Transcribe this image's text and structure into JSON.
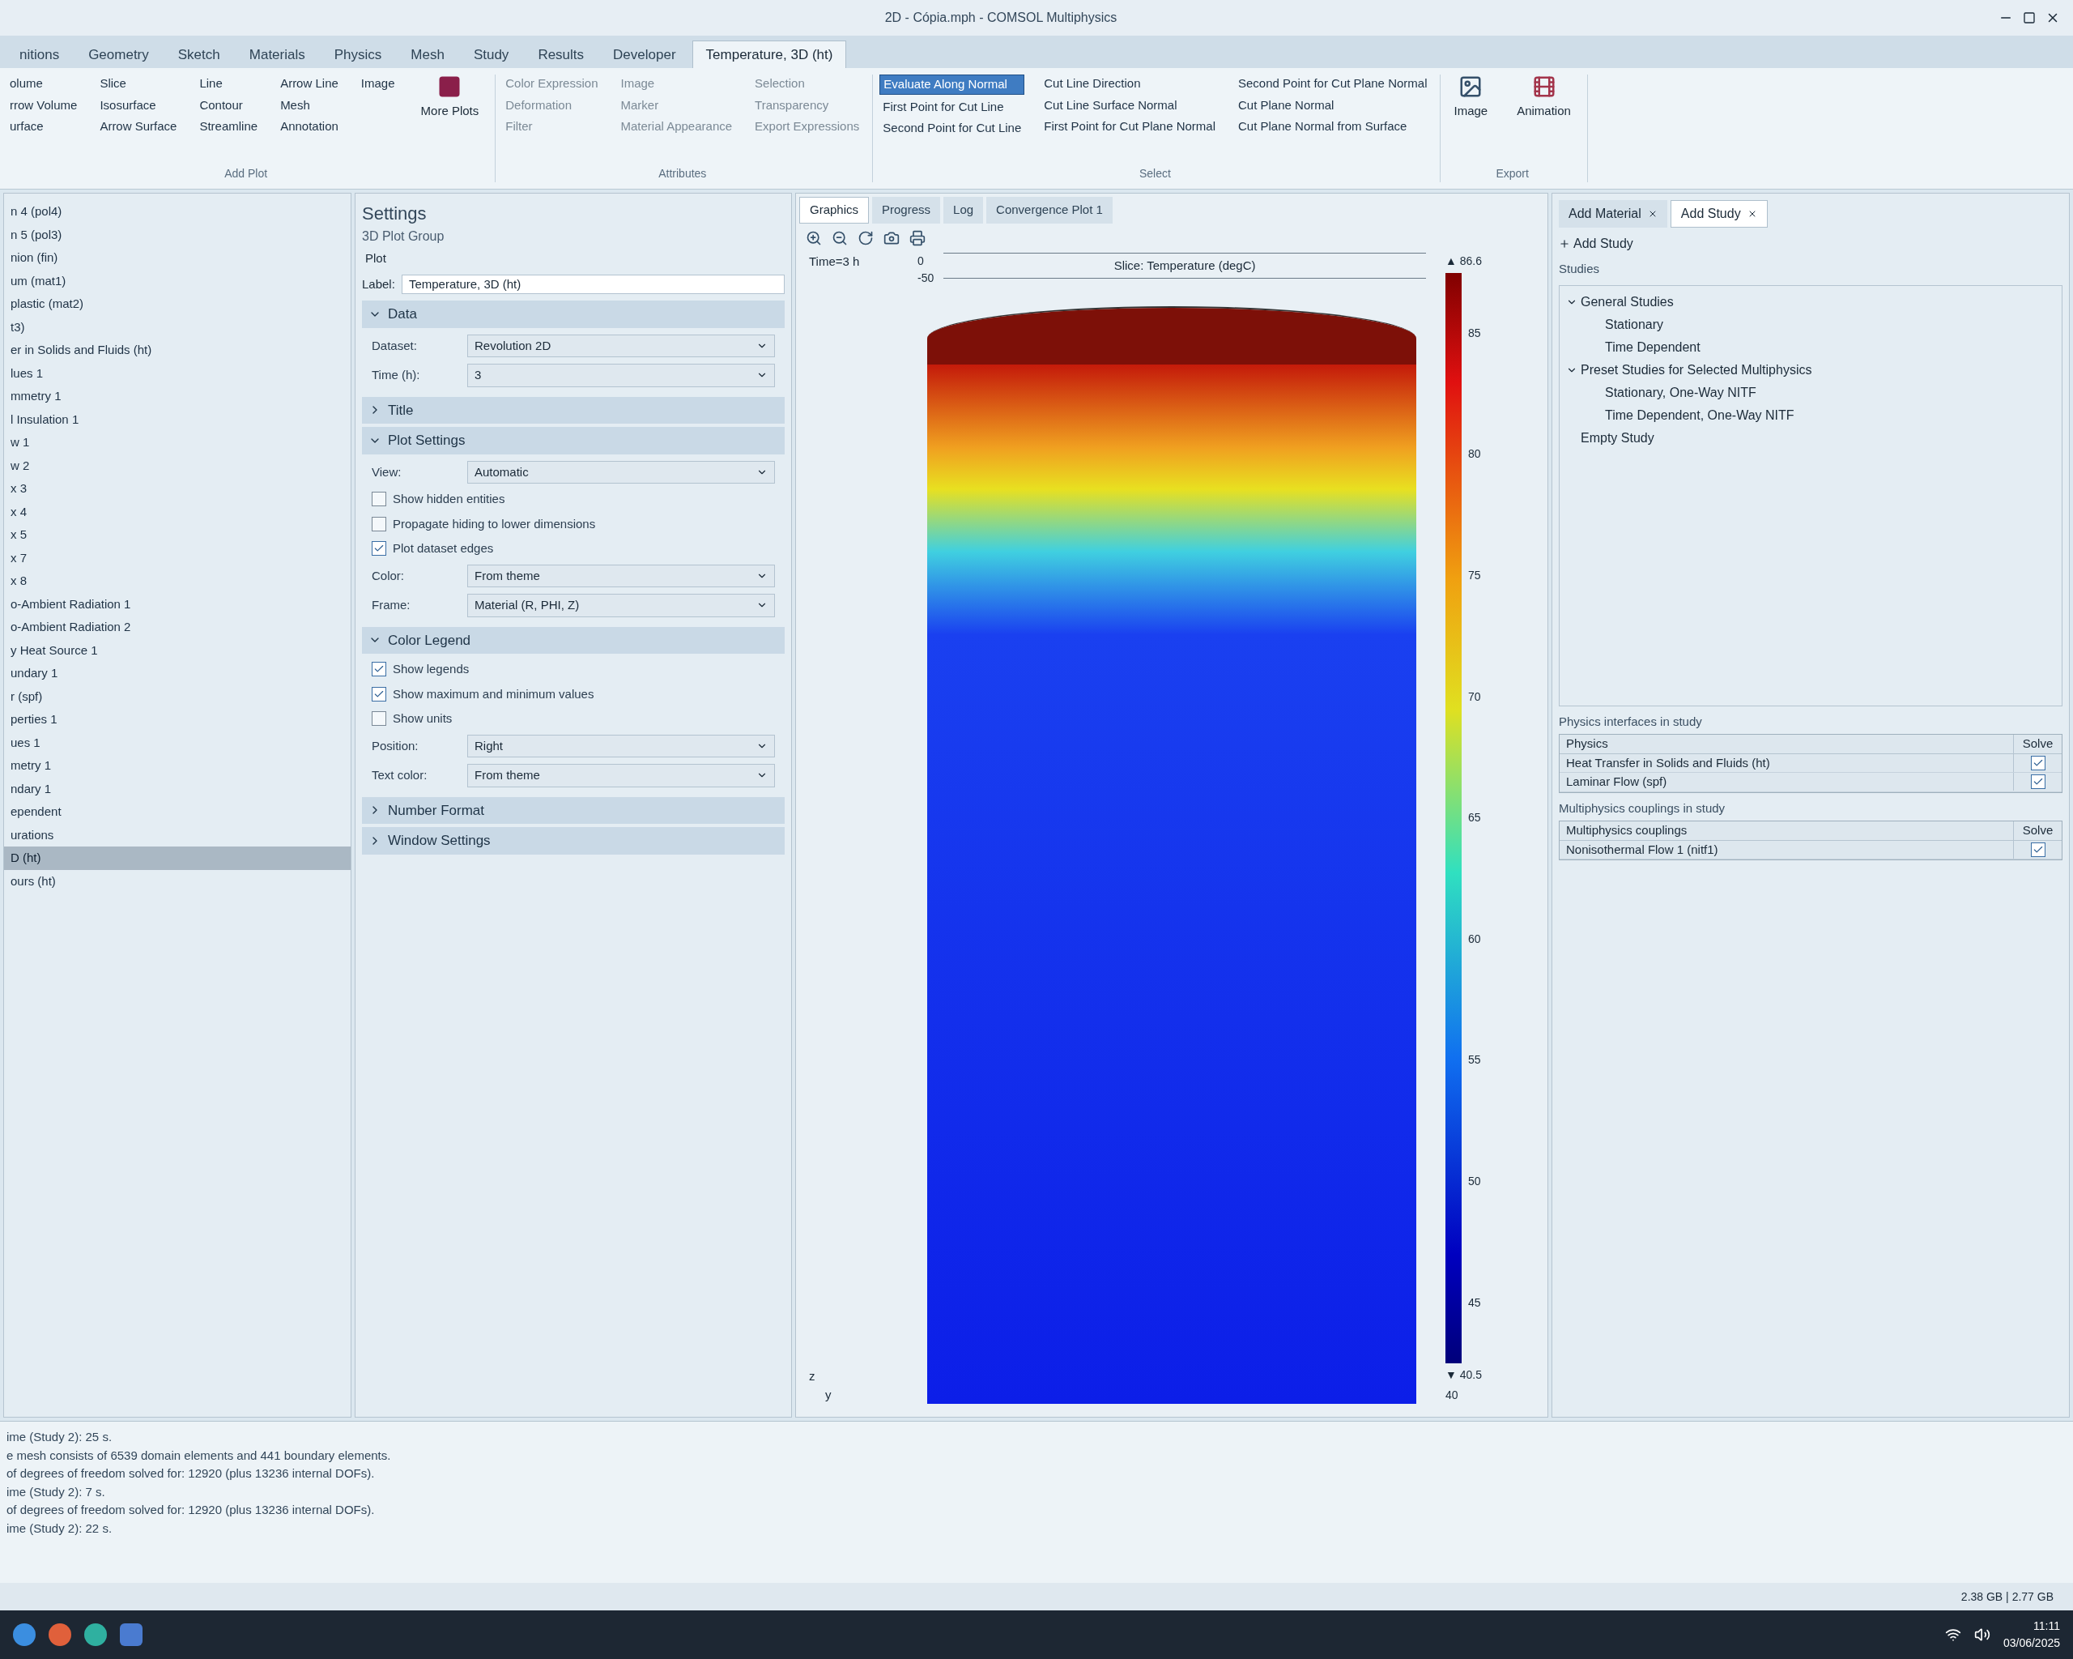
{
  "window": {
    "title": "2D - Cópia.mph - COMSOL Multiphysics"
  },
  "ribbon": {
    "tabs": [
      {
        "label": "nitions",
        "selected": false
      },
      {
        "label": "Geometry",
        "selected": false
      },
      {
        "label": "Sketch",
        "selected": false
      },
      {
        "label": "Materials",
        "selected": false
      },
      {
        "label": "Physics",
        "selected": false
      },
      {
        "label": "Mesh",
        "selected": false
      },
      {
        "label": "Study",
        "selected": false
      },
      {
        "label": "Results",
        "selected": false
      },
      {
        "label": "Developer",
        "selected": false
      },
      {
        "label": "Temperature, 3D (ht)",
        "selected": true
      }
    ],
    "groups": [
      {
        "title": "Add Plot",
        "columns": [
          [
            "olume",
            "rrow Volume",
            "urface"
          ],
          [
            "Slice",
            "Isosurface",
            "Arrow Surface"
          ],
          [
            "Line",
            "Contour",
            "Streamline"
          ],
          [
            "Arrow Line",
            "Mesh",
            "Annotation"
          ],
          [
            "Image"
          ]
        ],
        "large": [
          "More Plots"
        ]
      },
      {
        "title": "Attributes",
        "columns": [
          [
            "Color Expression",
            "Deformation",
            "Filter"
          ],
          [
            "Image",
            "Marker",
            "Material Appearance"
          ],
          [
            "Selection",
            "Transparency",
            "Export Expressions"
          ]
        ]
      },
      {
        "title": "Select",
        "columns": [
          [
            "Evaluate Along Normal",
            "First Point for Cut Line",
            "Second Point for Cut Line"
          ],
          [
            "Cut Line Direction",
            "Cut Line Surface Normal",
            "First Point for Cut Plane Normal"
          ],
          [
            "Second Point for Cut Plane Normal",
            "Cut Plane Normal",
            "Cut Plane Normal from Surface"
          ]
        ]
      },
      {
        "title": "Export",
        "large": [
          "Image",
          "Animation"
        ]
      }
    ]
  },
  "model_tree": {
    "items": [
      {
        "label": "n 4 (pol4)",
        "selected": false
      },
      {
        "label": "n 5 (pol3)",
        "selected": false
      },
      {
        "label": "nion (fin)",
        "selected": false
      },
      {
        "label": "um (mat1)",
        "selected": false
      },
      {
        "label": "plastic (mat2)",
        "selected": false
      },
      {
        "label": "t3)",
        "selected": false
      },
      {
        "label": "er in Solids and Fluids (ht)",
        "selected": false
      },
      {
        "label": "lues 1",
        "selected": false
      },
      {
        "label": "mmetry 1",
        "selected": false
      },
      {
        "label": "l Insulation 1",
        "selected": false
      },
      {
        "label": "w 1",
        "selected": false
      },
      {
        "label": "w 2",
        "selected": false
      },
      {
        "label": "x 3",
        "selected": false
      },
      {
        "label": "x 4",
        "selected": false
      },
      {
        "label": "x 5",
        "selected": false
      },
      {
        "label": "x 7",
        "selected": false
      },
      {
        "label": "x 8",
        "selected": false
      },
      {
        "label": "o-Ambient Radiation 1",
        "selected": false
      },
      {
        "label": "o-Ambient Radiation 2",
        "selected": false
      },
      {
        "label": "y Heat Source 1",
        "selected": false
      },
      {
        "label": "undary 1",
        "selected": false
      },
      {
        "label": "r (spf)",
        "selected": false
      },
      {
        "label": "perties 1",
        "selected": false
      },
      {
        "label": "ues 1",
        "selected": false
      },
      {
        "label": "metry 1",
        "selected": false
      },
      {
        "label": "ndary 1",
        "selected": false
      },
      {
        "label": "ependent",
        "selected": false
      },
      {
        "label": "urations",
        "selected": false
      },
      {
        "label": "D (ht)",
        "selected": true
      },
      {
        "label": "ours (ht)",
        "selected": false
      }
    ]
  },
  "settings": {
    "title": "Settings",
    "subtitle": "3D Plot Group",
    "plot_button": "Plot",
    "label_caption": "Label:",
    "label_value": "Temperature, 3D (ht)",
    "sections": [
      {
        "title": "Data",
        "expanded": true,
        "rows": [
          {
            "kind": "select",
            "label": "Dataset:",
            "value": "Revolution 2D"
          },
          {
            "kind": "select",
            "label": "Time (h):",
            "value": "3"
          }
        ]
      },
      {
        "title": "Title",
        "expanded": false
      },
      {
        "title": "Plot Settings",
        "expanded": true,
        "rows": [
          {
            "kind": "select",
            "label": "View:",
            "value": "Automatic"
          },
          {
            "kind": "check",
            "label": "Show hidden entities",
            "checked": false
          },
          {
            "kind": "check",
            "label": "Propagate hiding to lower dimensions",
            "checked": false
          },
          {
            "kind": "check",
            "label": "Plot dataset edges",
            "checked": true
          },
          {
            "kind": "select",
            "label": "Color:",
            "value": "From theme"
          },
          {
            "kind": "select",
            "label": "Frame:",
            "value": "Material (R, PHI, Z)"
          }
        ]
      },
      {
        "title": "Color Legend",
        "expanded": true,
        "rows": [
          {
            "kind": "check",
            "label": "Show legends",
            "checked": true
          },
          {
            "kind": "check",
            "label": "Show maximum and minimum values",
            "checked": true
          },
          {
            "kind": "check",
            "label": "Show units",
            "checked": false
          },
          {
            "kind": "select",
            "label": "Position:",
            "value": "Right"
          },
          {
            "kind": "select",
            "label": "Text color:",
            "value": "From theme"
          }
        ]
      },
      {
        "title": "Number Format",
        "expanded": false
      },
      {
        "title": "Window Settings",
        "expanded": false
      }
    ]
  },
  "graphics": {
    "tabs": [
      {
        "label": "Graphics",
        "selected": true
      },
      {
        "label": "Progress",
        "selected": false
      },
      {
        "label": "Log",
        "selected": false
      },
      {
        "label": "Convergence Plot 1",
        "selected": false
      }
    ],
    "time_label": "Time=3 h",
    "plot_title": "Slice: Temperature (degC)",
    "axis_ticks": [
      "0",
      "-50"
    ],
    "side_tick": "40",
    "legend": {
      "max": "▲ 86.6",
      "min": "▼ 40.5",
      "ticks": [
        "85",
        "80",
        "75",
        "70",
        "65",
        "60",
        "55",
        "50",
        "45"
      ]
    },
    "axes": [
      "z",
      "y"
    ]
  },
  "right_panel": {
    "tabs": [
      {
        "label": "Add Material",
        "selected": false
      },
      {
        "label": "Add Study",
        "selected": true
      }
    ],
    "add_button": "Add Study",
    "studies_caption": "Studies",
    "studies": [
      {
        "label": "General Studies",
        "expanded": true,
        "children": [
          {
            "label": "Stationary"
          },
          {
            "label": "Time Dependent"
          }
        ]
      },
      {
        "label": "Preset Studies for Selected Multiphysics",
        "expanded": true,
        "children": [
          {
            "label": "Stationary, One-Way NITF"
          },
          {
            "label": "Time Dependent, One-Way NITF"
          }
        ]
      },
      {
        "label": "Empty Study",
        "expanded": false
      }
    ],
    "physics_caption": "Physics interfaces in study",
    "physics_header": "Physics",
    "physics_solve_header": "Solve",
    "physics": [
      {
        "label": "Heat Transfer in Solids and Fluids (ht)",
        "checked": true
      },
      {
        "label": "Laminar Flow (spf)",
        "checked": true
      }
    ],
    "couplings_caption": "Multiphysics couplings in study",
    "couplings_header": "Multiphysics couplings",
    "couplings_solve_header": "Solve",
    "couplings": [
      {
        "label": "Nonisothermal Flow 1 (nitf1)",
        "checked": true
      }
    ]
  },
  "messages": [
    "ime (Study 2): 25 s.",
    "e mesh consists of 6539 domain elements and 441 boundary elements.",
    "of degrees of freedom solved for: 12920 (plus 13236 internal DOFs).",
    "ime (Study 2): 7 s.",
    "of degrees of freedom solved for: 12920 (plus 13236 internal DOFs).",
    "ime (Study 2): 22 s."
  ],
  "status_bar": {
    "memory": "2.38 GB | 2.77 GB"
  },
  "taskbar": {
    "time": "11:11",
    "date": "03/06/2025"
  }
}
